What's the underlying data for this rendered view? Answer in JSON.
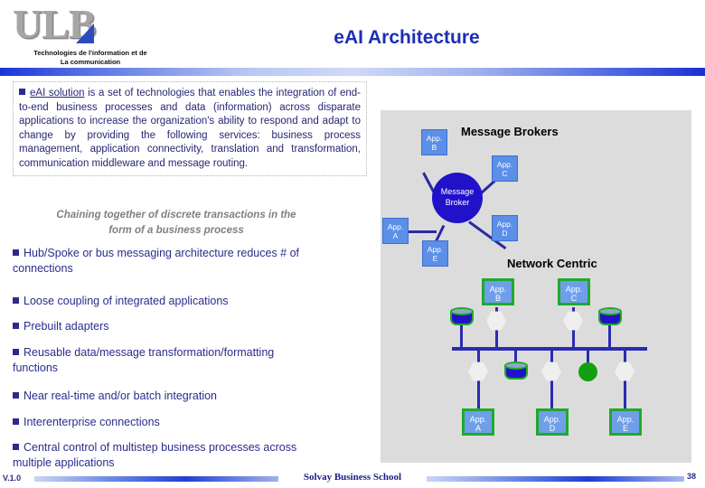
{
  "header": {
    "logo_text": "ULB",
    "logo_subtitle": "Technologies de l'information et de\nLa communication",
    "logo_subtitle_line1": "Technologies de l'information et de",
    "logo_subtitle_line2": "La communication",
    "title": "eAI Architecture"
  },
  "definition": {
    "term": "eAI solution",
    "body": " is a set of technologies that enables the integration of end-to-end business processes and data (information) across disparate applications to increase the organization's ability to respond and adapt to change by providing the following services: business process management, application connectivity, translation and transformation, communication middleware and message routing."
  },
  "note": {
    "line1": "Chaining together of discrete transactions in the",
    "line2": "form of a business process"
  },
  "bullets": [
    "Hub/Spoke or bus messaging architecture reduces # of connections",
    "Loose coupling of integrated applications",
    "Prebuilt adapters",
    "Reusable data/message transformation/formatting functions",
    "Near real-time and/or batch integration",
    "Interenterprise connections",
    "Central control of multistep business processes across multiple applications"
  ],
  "diagrams": {
    "hub": {
      "caption": "Message Brokers",
      "center_line1": "Message",
      "center_line2": "Broker",
      "nodes": [
        {
          "id": "A",
          "line1": "App.",
          "line2": "A"
        },
        {
          "id": "B",
          "line1": "App.",
          "line2": "B"
        },
        {
          "id": "C",
          "line1": "App.",
          "line2": "C"
        },
        {
          "id": "D",
          "line1": "App.",
          "line2": "D"
        },
        {
          "id": "E",
          "line1": "App.",
          "line2": "E"
        }
      ]
    },
    "bus": {
      "caption": "Network Centric",
      "nodes": [
        {
          "id": "B",
          "line1": "App.",
          "line2": "B"
        },
        {
          "id": "C",
          "line1": "App.",
          "line2": "C"
        },
        {
          "id": "A",
          "line1": "App.",
          "line2": "A"
        },
        {
          "id": "D",
          "line1": "App.",
          "line2": "D"
        },
        {
          "id": "E",
          "line1": "App.",
          "line2": "E"
        }
      ]
    }
  },
  "footer": {
    "version": "V.1.0",
    "school": "Solvay Business School",
    "page": "38"
  },
  "colors": {
    "title_blue": "#1b2fb5",
    "text_navy": "#2b2b8f",
    "note_gray": "#808080",
    "panel_gray": "#dcdcdc",
    "app_blue": "#5b8fe8",
    "broker_blue": "#2111c9",
    "adapter_green": "#1faa2b"
  }
}
